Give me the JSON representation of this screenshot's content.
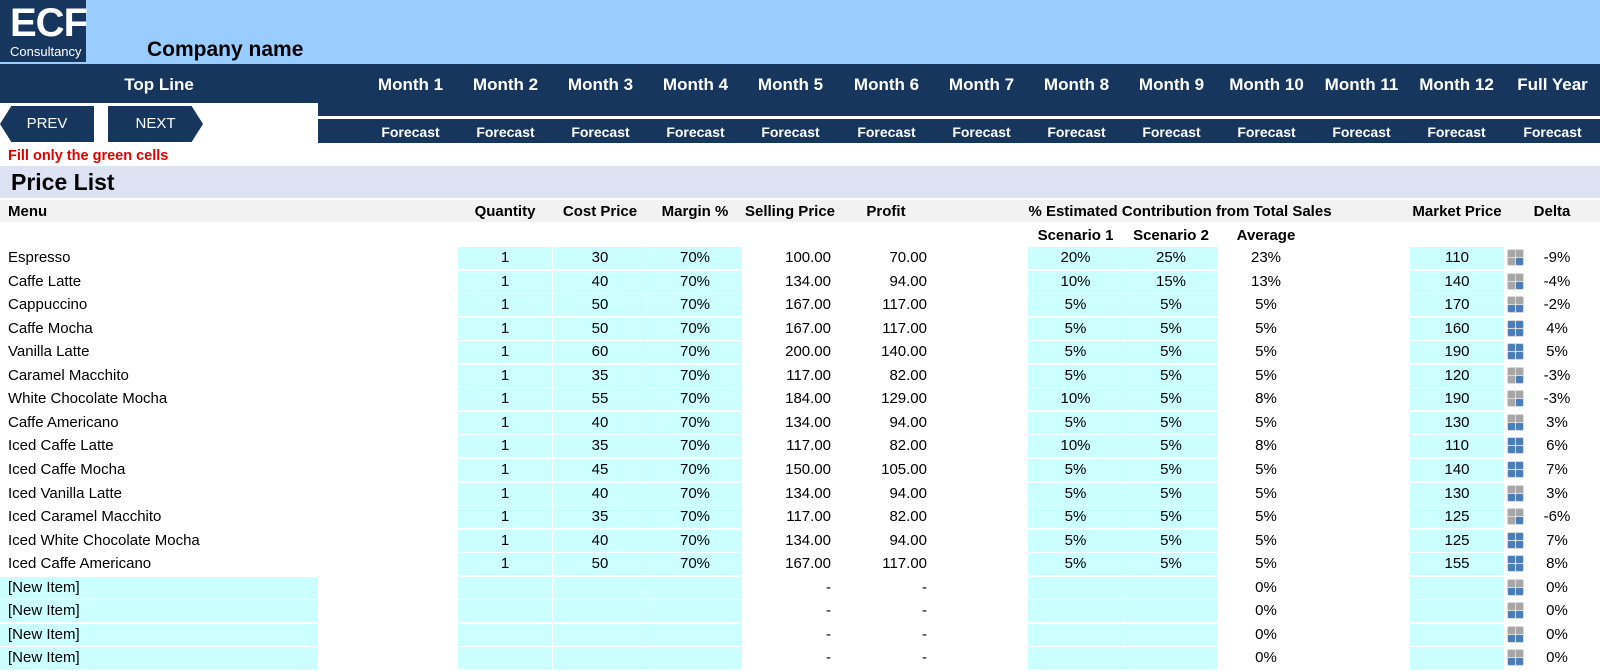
{
  "logo": {
    "line1": "ECF",
    "line2": "Consultancy"
  },
  "company_name": "Company name",
  "top_line_label": "Top Line",
  "months": [
    "Month 1",
    "Month 2",
    "Month 3",
    "Month 4",
    "Month 5",
    "Month 6",
    "Month 7",
    "Month 8",
    "Month 9",
    "Month 10",
    "Month 11",
    "Month 12",
    "Full Year"
  ],
  "forecast_label": "Forecast",
  "nav": {
    "prev": "PREV",
    "next": "NEXT"
  },
  "instruction": "Fill only the green cells",
  "section_title": "Price List",
  "columns": {
    "menu": "Menu",
    "quantity": "Quantity",
    "cost_price": "Cost Price",
    "margin": "Margin %",
    "selling_price": "Selling Price",
    "profit": "Profit",
    "contribution": "% Estimated Contribution from Total Sales",
    "scenario1": "Scenario 1",
    "scenario2": "Scenario 2",
    "average": "Average",
    "market_price": "Market Price",
    "delta": "Delta"
  },
  "colors": {
    "navy": "#17365d",
    "light_blue": "#99ccff",
    "input_green": "#ccffff",
    "red_note": "#e00000",
    "icon_blue": "#4a7ebb",
    "icon_gray": "#a6a6a6"
  },
  "rows": [
    {
      "menu": "Espresso",
      "qty": "1",
      "cost": "30",
      "margin": "70%",
      "sell": "100.00",
      "profit": "70.00",
      "s1": "20%",
      "s2": "25%",
      "avg": "23%",
      "market": "110",
      "icon": "down",
      "delta": "-9%"
    },
    {
      "menu": "Caffe Latte",
      "qty": "1",
      "cost": "40",
      "margin": "70%",
      "sell": "134.00",
      "profit": "94.00",
      "s1": "10%",
      "s2": "15%",
      "avg": "13%",
      "market": "140",
      "icon": "down",
      "delta": "-4%"
    },
    {
      "menu": "Cappuccino",
      "qty": "1",
      "cost": "50",
      "margin": "70%",
      "sell": "167.00",
      "profit": "117.00",
      "s1": "5%",
      "s2": "5%",
      "avg": "5%",
      "market": "170",
      "icon": "mid",
      "delta": "-2%"
    },
    {
      "menu": "Caffe Mocha",
      "qty": "1",
      "cost": "50",
      "margin": "70%",
      "sell": "167.00",
      "profit": "117.00",
      "s1": "5%",
      "s2": "5%",
      "avg": "5%",
      "market": "160",
      "icon": "up",
      "delta": "4%"
    },
    {
      "menu": "Vanilla Latte",
      "qty": "1",
      "cost": "60",
      "margin": "70%",
      "sell": "200.00",
      "profit": "140.00",
      "s1": "5%",
      "s2": "5%",
      "avg": "5%",
      "market": "190",
      "icon": "up",
      "delta": "5%"
    },
    {
      "menu": "Caramel Macchito",
      "qty": "1",
      "cost": "35",
      "margin": "70%",
      "sell": "117.00",
      "profit": "82.00",
      "s1": "5%",
      "s2": "5%",
      "avg": "5%",
      "market": "120",
      "icon": "down",
      "delta": "-3%"
    },
    {
      "menu": "White Chocolate Mocha",
      "qty": "1",
      "cost": "55",
      "margin": "70%",
      "sell": "184.00",
      "profit": "129.00",
      "s1": "10%",
      "s2": "5%",
      "avg": "8%",
      "market": "190",
      "icon": "down",
      "delta": "-3%"
    },
    {
      "menu": "Caffe Americano",
      "qty": "1",
      "cost": "40",
      "margin": "70%",
      "sell": "134.00",
      "profit": "94.00",
      "s1": "5%",
      "s2": "5%",
      "avg": "5%",
      "market": "130",
      "icon": "mid",
      "delta": "3%"
    },
    {
      "menu": "Iced Caffe Latte",
      "qty": "1",
      "cost": "35",
      "margin": "70%",
      "sell": "117.00",
      "profit": "82.00",
      "s1": "10%",
      "s2": "5%",
      "avg": "8%",
      "market": "110",
      "icon": "up",
      "delta": "6%"
    },
    {
      "menu": "Iced Caffe Mocha",
      "qty": "1",
      "cost": "45",
      "margin": "70%",
      "sell": "150.00",
      "profit": "105.00",
      "s1": "5%",
      "s2": "5%",
      "avg": "5%",
      "market": "140",
      "icon": "up",
      "delta": "7%"
    },
    {
      "menu": "Iced Vanilla Latte",
      "qty": "1",
      "cost": "40",
      "margin": "70%",
      "sell": "134.00",
      "profit": "94.00",
      "s1": "5%",
      "s2": "5%",
      "avg": "5%",
      "market": "130",
      "icon": "mid",
      "delta": "3%"
    },
    {
      "menu": "Iced Caramel Macchito",
      "qty": "1",
      "cost": "35",
      "margin": "70%",
      "sell": "117.00",
      "profit": "82.00",
      "s1": "5%",
      "s2": "5%",
      "avg": "5%",
      "market": "125",
      "icon": "down",
      "delta": "-6%"
    },
    {
      "menu": "Iced White Chocolate Mocha",
      "qty": "1",
      "cost": "40",
      "margin": "70%",
      "sell": "134.00",
      "profit": "94.00",
      "s1": "5%",
      "s2": "5%",
      "avg": "5%",
      "market": "125",
      "icon": "up",
      "delta": "7%"
    },
    {
      "menu": "Iced Caffe Americano",
      "qty": "1",
      "cost": "50",
      "margin": "70%",
      "sell": "167.00",
      "profit": "117.00",
      "s1": "5%",
      "s2": "5%",
      "avg": "5%",
      "market": "155",
      "icon": "up",
      "delta": "8%"
    },
    {
      "menu": "[New Item]",
      "qty": "",
      "cost": "",
      "margin": "",
      "sell": "-",
      "profit": "-",
      "s1": "",
      "s2": "",
      "avg": "0%",
      "market": "",
      "icon": "mid",
      "delta": "0%",
      "newitem": true
    },
    {
      "menu": "[New Item]",
      "qty": "",
      "cost": "",
      "margin": "",
      "sell": "-",
      "profit": "-",
      "s1": "",
      "s2": "",
      "avg": "0%",
      "market": "",
      "icon": "mid",
      "delta": "0%",
      "newitem": true
    },
    {
      "menu": "[New Item]",
      "qty": "",
      "cost": "",
      "margin": "",
      "sell": "-",
      "profit": "-",
      "s1": "",
      "s2": "",
      "avg": "0%",
      "market": "",
      "icon": "mid",
      "delta": "0%",
      "newitem": true
    },
    {
      "menu": "[New Item]",
      "qty": "",
      "cost": "",
      "margin": "",
      "sell": "-",
      "profit": "-",
      "s1": "",
      "s2": "",
      "avg": "0%",
      "market": "",
      "icon": "mid",
      "delta": "0%",
      "newitem": true
    }
  ]
}
